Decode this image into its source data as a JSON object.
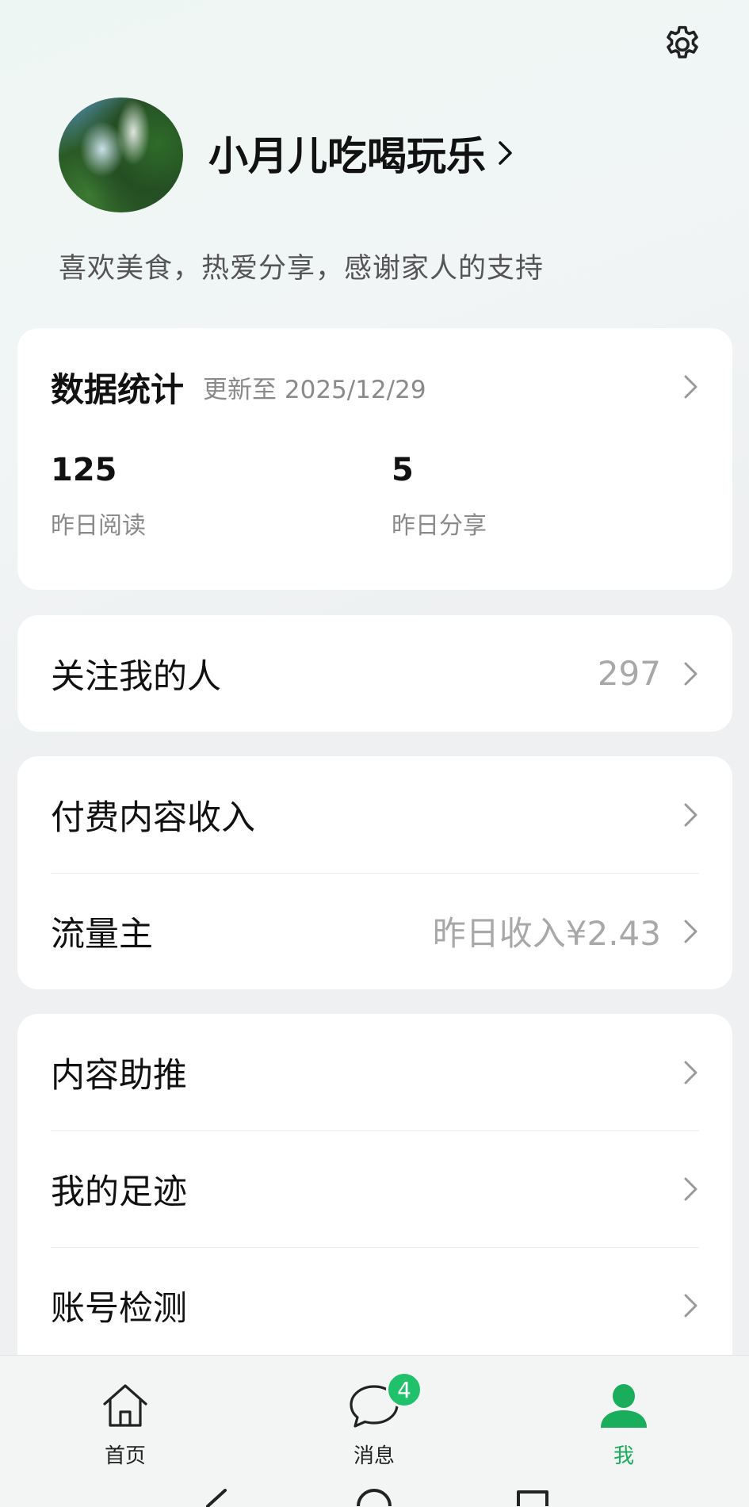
{
  "header": {
    "settings_icon": "gear-icon",
    "username": "小月儿吃喝玩乐",
    "bio": "喜欢美食，热爱分享，感谢家人的支持"
  },
  "stats": {
    "title": "数据统计",
    "updated": "更新至 2025/12/29",
    "items": [
      {
        "value": "125",
        "label": "昨日阅读"
      },
      {
        "value": "5",
        "label": "昨日分享"
      }
    ]
  },
  "follow": {
    "label": "关注我的人",
    "value": "297"
  },
  "income": {
    "items": [
      {
        "label": "付费内容收入",
        "value": ""
      },
      {
        "label": "流量主",
        "value": "昨日收入¥2.43"
      }
    ]
  },
  "tools": {
    "items": [
      {
        "label": "内容助推"
      },
      {
        "label": "我的足迹"
      },
      {
        "label": "账号检测"
      }
    ]
  },
  "nav": {
    "items": [
      {
        "label": "首页",
        "icon": "home-icon"
      },
      {
        "label": "消息",
        "icon": "chat-icon",
        "badge": "4"
      },
      {
        "label": "我",
        "icon": "person-icon",
        "active": true
      }
    ]
  },
  "colors": {
    "accent": "#1aad5b",
    "badge": "#1fc16b"
  }
}
